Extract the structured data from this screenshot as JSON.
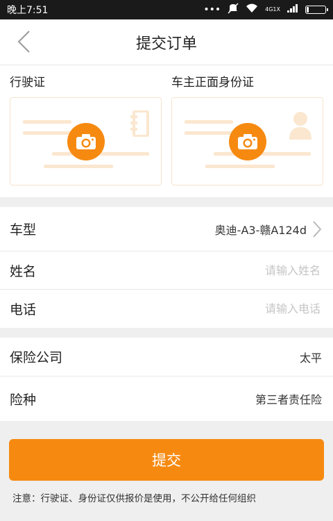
{
  "status_bar": {
    "time": "晚上7:51",
    "network": "4G",
    "signal_label": "1X"
  },
  "navbar": {
    "title": "提交订单"
  },
  "id_upload": {
    "vehicle_license_label": "行驶证",
    "owner_id_front_label": "车主正面身份证"
  },
  "vehicle": {
    "label": "车型",
    "value": "奥迪-A3-赣A124d"
  },
  "name": {
    "label": "姓名",
    "placeholder": "请输入姓名"
  },
  "phone": {
    "label": "电话",
    "placeholder": "请输入电话"
  },
  "insurance_company": {
    "label": "保险公司",
    "value": "太平"
  },
  "insurance_type": {
    "label": "险种",
    "value": "第三者责任险"
  },
  "submit": {
    "label": "提交"
  },
  "note": "注意：行驶证、身份证仅供报价是使用，不公开给任何组织",
  "colors": {
    "accent": "#f68a11",
    "accent_light": "#fbe7cf"
  }
}
